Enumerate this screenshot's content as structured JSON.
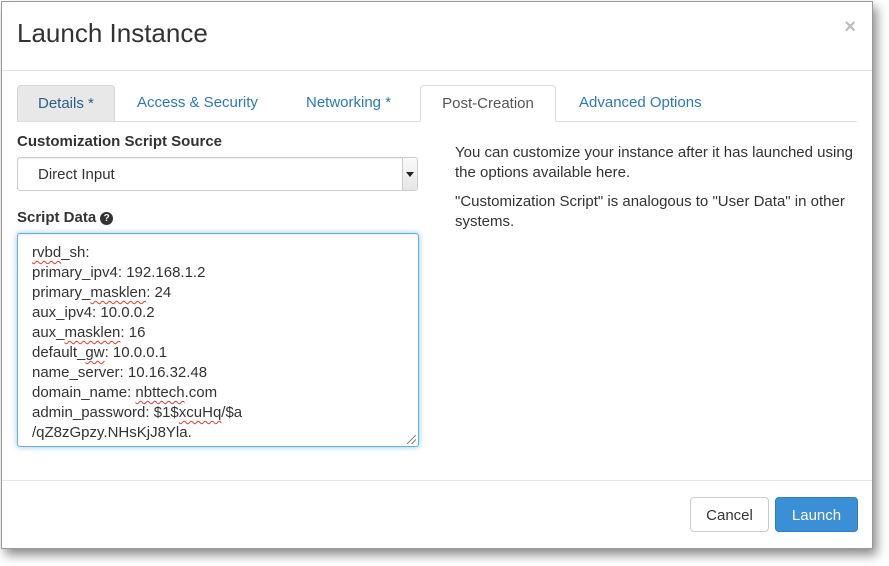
{
  "modal": {
    "title": "Launch Instance",
    "close_glyph": "×"
  },
  "tabs": [
    {
      "label": "Details *"
    },
    {
      "label": "Access & Security"
    },
    {
      "label": "Networking *"
    },
    {
      "label": "Post-Creation"
    },
    {
      "label": "Advanced Options"
    }
  ],
  "active_tab": "Post-Creation",
  "form": {
    "source_label": "Customization Script Source",
    "source_value": "Direct Input",
    "script_label": "Script Data",
    "help_glyph": "?",
    "script_lines": [
      {
        "a": "",
        "b": "rvbd",
        "c": "_sh:"
      },
      {
        "a": "primary_ipv4: 192.168.1.2",
        "b": "",
        "c": ""
      },
      {
        "a": "primary_",
        "b": "masklen",
        "c": ": 24"
      },
      {
        "a": "aux_ipv4: 10.0.0.2",
        "b": "",
        "c": ""
      },
      {
        "a": "aux_",
        "b": "masklen",
        "c": ": 16"
      },
      {
        "a": "default_",
        "b": "gw",
        "c": ": 10.0.0.1"
      },
      {
        "a": "name_server: 10.16.32.48",
        "b": "",
        "c": ""
      },
      {
        "a": "domain_name: ",
        "b": "nbttech",
        "c": ".com"
      },
      {
        "a": "admin_password: $1$",
        "b": "xcuHq",
        "c": "/$a"
      },
      {
        "a": "/qZ8zGpzy.NHsKjJ8Yla.",
        "b": "",
        "c": ""
      }
    ]
  },
  "info": {
    "paragraph1": "You can customize your instance after it has launched using the options available here.",
    "paragraph2": "\"Customization Script\" is analogous to \"User Data\" in other systems."
  },
  "footer": {
    "cancel_label": "Cancel",
    "launch_label": "Launch"
  },
  "colors": {
    "accent": "#3a8fd6",
    "link": "#2a7ab9",
    "focus": "#66afe9"
  }
}
